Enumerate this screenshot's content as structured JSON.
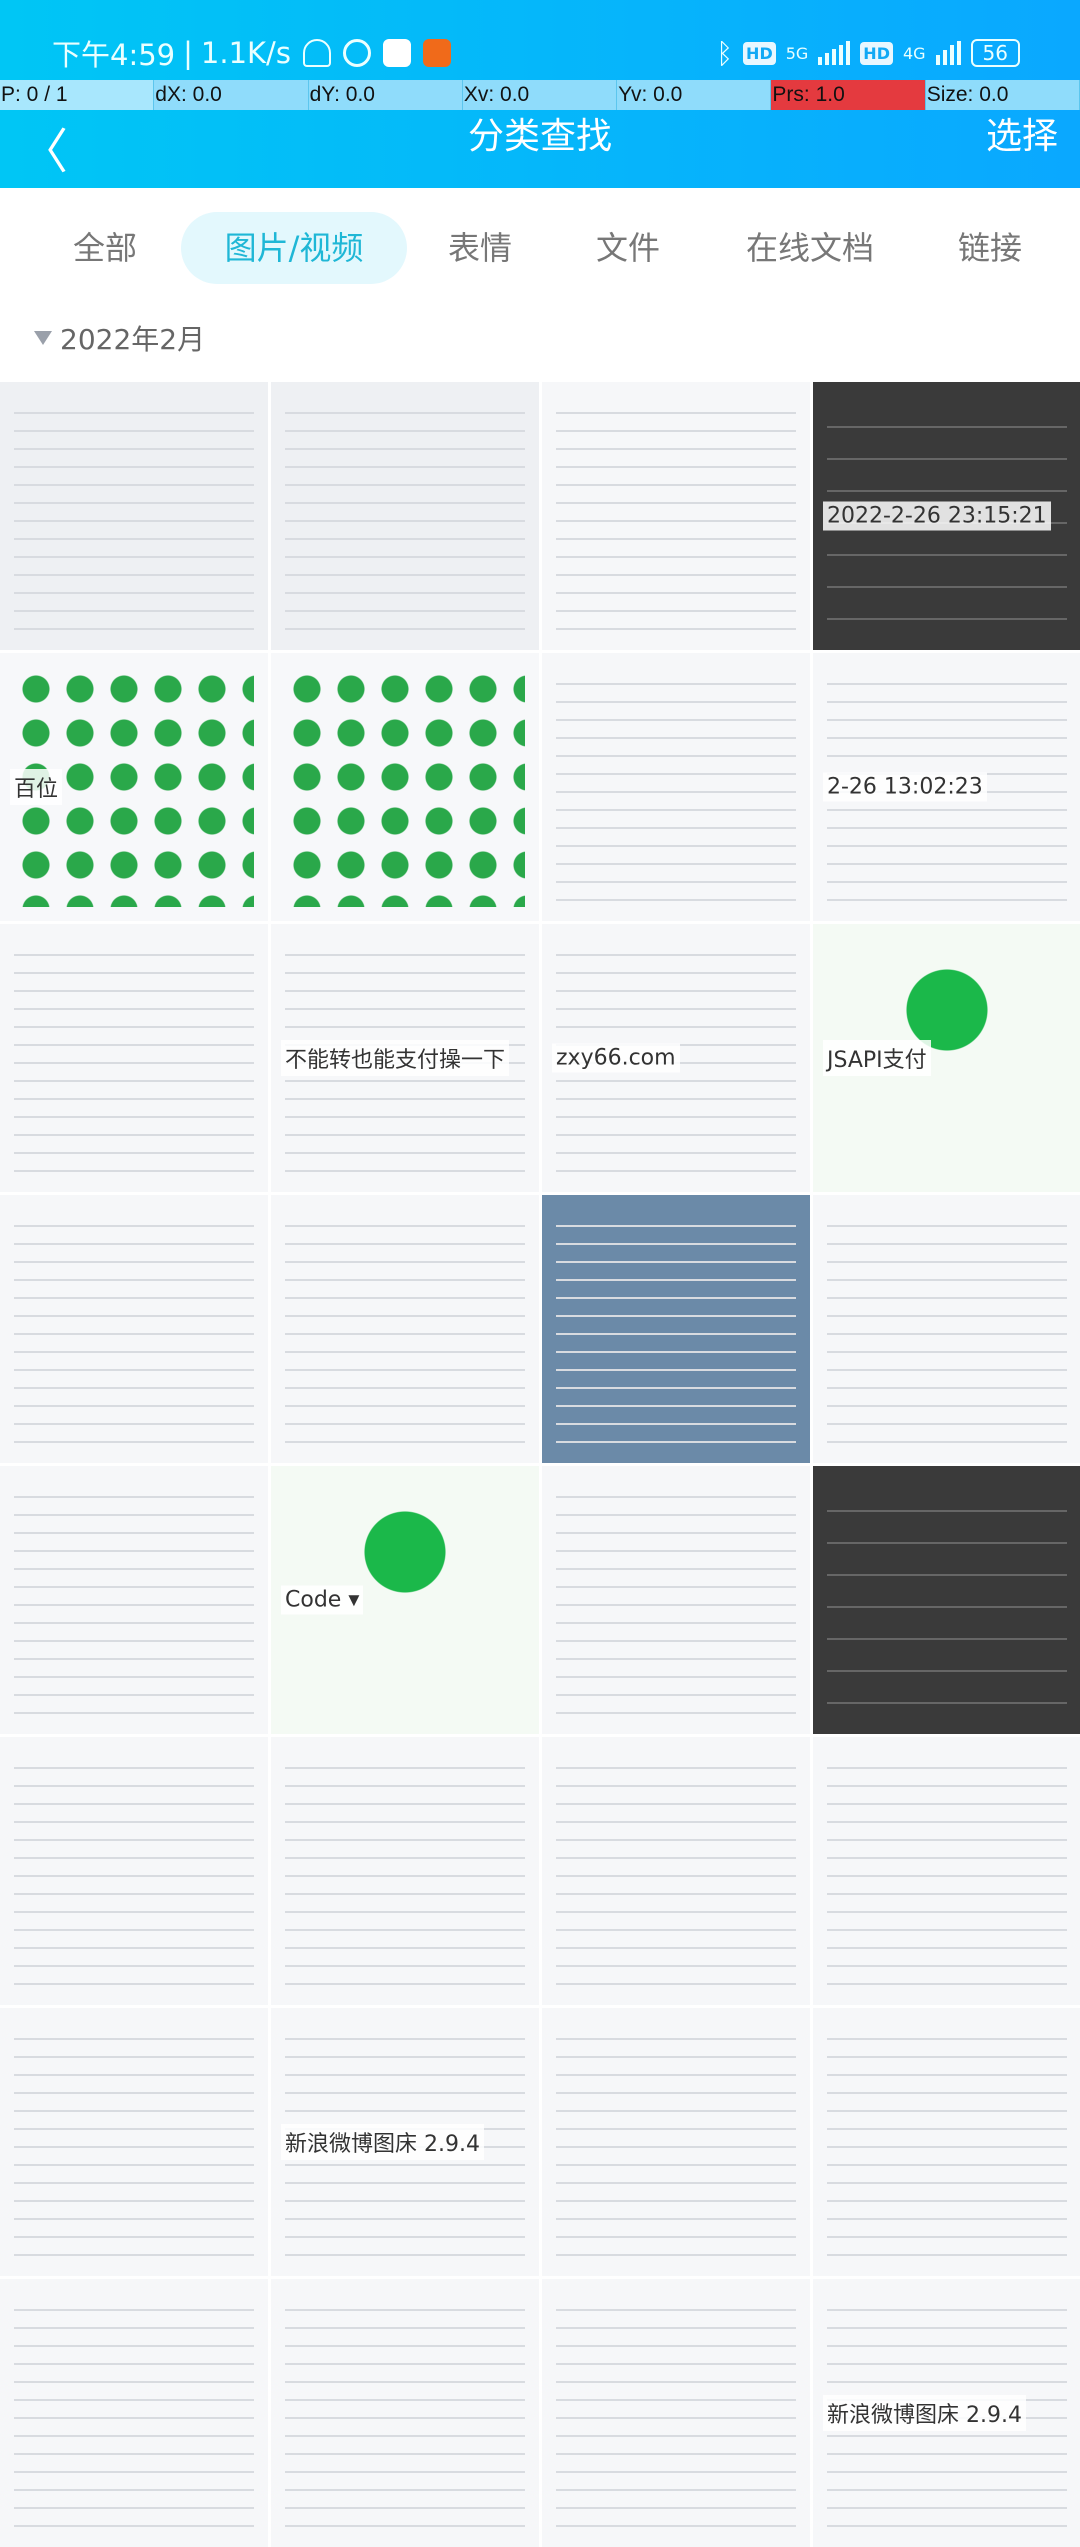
{
  "status_bar": {
    "time": "下午4:59",
    "speed": "1.1K/s",
    "battery": "56",
    "net1": "5G",
    "net2": "4G",
    "hd": "HD"
  },
  "debug_bar": [
    "P: 0 / 1",
    "dX: 0.0",
    "dY: 0.0",
    "Xv: 0.0",
    "Yv: 0.0",
    "Prs: 1.0",
    "Size: 0.0"
  ],
  "header": {
    "back": "〈",
    "title": "分类查找",
    "select": "选择"
  },
  "tabs": [
    {
      "label": "全部"
    },
    {
      "label": "图片/视频",
      "active": true
    },
    {
      "label": "表情"
    },
    {
      "label": "文件"
    },
    {
      "label": "在线文档"
    },
    {
      "label": "链接"
    }
  ],
  "group_label": "2022年2月",
  "colors": {
    "accent": "#1fb7d6",
    "header": "#0aa8ff",
    "debug_red": "#e43a3f"
  },
  "tiles": [
    {
      "kind": "chat"
    },
    {
      "kind": "chat"
    },
    {
      "kind": "doc"
    },
    {
      "kind": "dark",
      "text": "2022-2-26 23:15:21"
    },
    {
      "kind": "numbers",
      "text": "百位"
    },
    {
      "kind": "numbers"
    },
    {
      "kind": "doc"
    },
    {
      "kind": "doc",
      "text": "2-26 13:02:23"
    },
    {
      "kind": "doc"
    },
    {
      "kind": "doc",
      "text": "不能转也能支付操一下"
    },
    {
      "kind": "doc",
      "text": "zxy66.com"
    },
    {
      "kind": "green",
      "text": "JSAPI支付"
    },
    {
      "kind": "doc"
    },
    {
      "kind": "doc"
    },
    {
      "kind": "desktop"
    },
    {
      "kind": "doc"
    },
    {
      "kind": "doc"
    },
    {
      "kind": "green",
      "text": "Code ▾"
    },
    {
      "kind": "doc"
    },
    {
      "kind": "dark"
    },
    {
      "kind": "doc"
    },
    {
      "kind": "doc"
    },
    {
      "kind": "doc"
    },
    {
      "kind": "doc"
    },
    {
      "kind": "doc"
    },
    {
      "kind": "doc",
      "text": "新浪微博图床 2.9.4"
    },
    {
      "kind": "doc"
    },
    {
      "kind": "doc"
    },
    {
      "kind": "doc"
    },
    {
      "kind": "doc"
    },
    {
      "kind": "doc"
    },
    {
      "kind": "doc",
      "text": "新浪微博图床 2.9.4"
    }
  ]
}
